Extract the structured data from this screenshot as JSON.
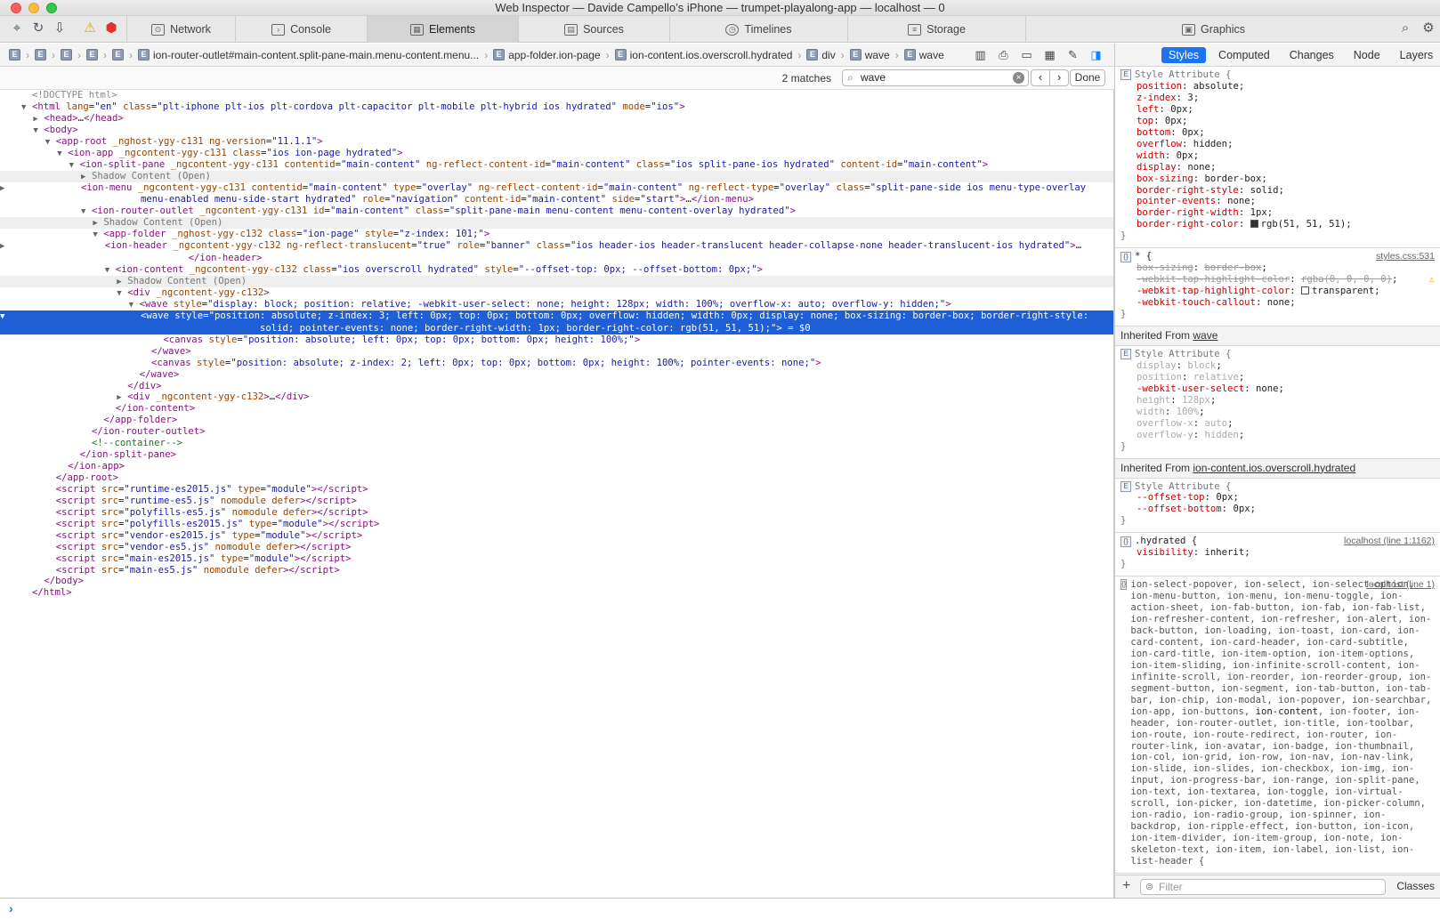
{
  "window": {
    "title": "Web Inspector — Davide Campello’s iPhone — trumpet-playalong-app — localhost — 0"
  },
  "toolbar": {
    "icons": [
      "crosshair-icon",
      "reload-icon",
      "download-icon",
      "warning-icon",
      "error-icon"
    ],
    "tabs": [
      {
        "label": "Network",
        "icon": "network-icon"
      },
      {
        "label": "Console",
        "icon": "console-icon"
      },
      {
        "label": "Elements",
        "icon": "elements-icon",
        "active": true
      },
      {
        "label": "Sources",
        "icon": "sources-icon"
      },
      {
        "label": "Timelines",
        "icon": "timelines-icon"
      },
      {
        "label": "Storage",
        "icon": "storage-icon"
      },
      {
        "label": "Graphics",
        "icon": "graphics-icon"
      }
    ]
  },
  "breadcrumb": {
    "items": [
      "",
      "",
      "",
      "",
      "",
      "ion-router-outlet#main-content.split-pane-main.menu-content.menu...",
      "app-folder.ion-page",
      "ion-content.ios.overscroll.hydrated",
      "div",
      "wave",
      "wave"
    ]
  },
  "sidebar_tabs": [
    "Styles",
    "Computed",
    "Changes",
    "Node",
    "Layers"
  ],
  "find": {
    "matches": "2 matches",
    "query": "wave",
    "done": "Done"
  },
  "dom_lines": [
    {
      "i": 0,
      "t": "none",
      "h": "<span class='dt'>&lt;!DOCTYPE html&gt;</span>"
    },
    {
      "i": 0,
      "t": "open",
      "h": "<span class='tg'>&lt;html</span> <span class='an'>lang</span>=<span class='av'>\"en\"</span> <span class='an'>class</span>=<span class='av'>\"plt-iphone plt-ios plt-cordova plt-capacitor plt-mobile plt-hybrid ios hydrated\"</span> <span class='an'>mode</span>=<span class='av'>\"ios\"</span><span class='tg'>&gt;</span>"
    },
    {
      "i": 1,
      "t": "closed",
      "h": "<span class='tg'>&lt;head&gt;</span><span class='tx'>…</span><span class='tg'>&lt;/head&gt;</span>"
    },
    {
      "i": 1,
      "t": "open",
      "h": "<span class='tg'>&lt;body&gt;</span>"
    },
    {
      "i": 2,
      "t": "open",
      "h": "<span class='tg'>&lt;app-root</span> <span class='an'>_nghost-ygy-c131</span> <span class='an'>ng-version</span>=<span class='av'>\"11.1.1\"</span><span class='tg'>&gt;</span>"
    },
    {
      "i": 3,
      "t": "open",
      "h": "<span class='tg'>&lt;ion-app</span> <span class='an'>_ngcontent-ygy-c131</span> <span class='an'>class</span>=<span class='av'>\"ios ion-page hydrated\"</span><span class='tg'>&gt;</span>"
    },
    {
      "i": 4,
      "t": "open",
      "h": "<span class='tg'>&lt;ion-split-pane</span> <span class='an'>_ngcontent-ygy-c131</span> <span class='an'>contentid</span>=<span class='av'>\"main-content\"</span> <span class='an'>ng-reflect-content-id</span>=<span class='av'>\"main-content\"</span> <span class='an'>class</span>=<span class='av'>\"ios split-pane-ios hydrated\"</span> <span class='an'>content-id</span>=<span class='av'>\"main-content\"</span><span class='tg'>&gt;</span>"
    },
    {
      "i": 5,
      "t": "closed",
      "c": "shadow",
      "h": "Shadow Content (Open)"
    },
    {
      "i": 5,
      "t": "closed",
      "w": true,
      "h": "<span class='tg'>&lt;ion-menu</span> <span class='an'>_ngcontent-ygy-c131</span> <span class='an'>contentid</span>=<span class='av'>\"main-content\"</span> <span class='an'>type</span>=<span class='av'>\"overlay\"</span> <span class='an'>ng-reflect-content-id</span>=<span class='av'>\"main-content\"</span> <span class='an'>ng-reflect-type</span>=<span class='av'>\"overlay\"</span> <span class='an'>class</span>=<span class='av'>\"split-pane-side ios menu-type-overlay menu-enabled menu-side-start hydrated\"</span> <span class='an'>role</span>=<span class='av'>\"navigation\"</span> <span class='an'>content-id</span>=<span class='av'>\"main-content\"</span> <span class='an'>side</span>=<span class='av'>\"start\"</span><span class='tg'>&gt;</span><span class='tx'>…</span><span class='tg'>&lt;/ion-menu&gt;</span>"
    },
    {
      "i": 5,
      "t": "open",
      "h": "<span class='tg'>&lt;ion-router-outlet</span> <span class='an'>_ngcontent-ygy-c131</span> <span class='an'>id</span>=<span class='av'>\"main-content\"</span> <span class='an'>class</span>=<span class='av'>\"split-pane-main menu-content menu-content-overlay hydrated\"</span><span class='tg'>&gt;</span>"
    },
    {
      "i": 6,
      "t": "closed",
      "c": "shadow",
      "h": "Shadow Content (Open)"
    },
    {
      "i": 6,
      "t": "open",
      "h": "<span class='tg'>&lt;app-folder</span> <span class='an'>_nghost-ygy-c132</span> <span class='an'>class</span>=<span class='av'>\"ion-page\"</span> <span class='an'>style</span>=<span class='av'>\"z-index: 101;\"</span><span class='tg'>&gt;</span>"
    },
    {
      "i": 7,
      "t": "closed",
      "w": true,
      "h": "<span class='tg'>&lt;ion-header</span> <span class='an'>_ngcontent-ygy-c132</span> <span class='an'>ng-reflect-translucent</span>=<span class='av'>\"true\"</span> <span class='an'>role</span>=<span class='av'>\"banner\"</span> <span class='an'>class</span>=<span class='av'>\"ios header-ios header-translucent header-collapse-none header-translucent-ios hydrated\"</span><span class='tg'>&gt;</span><span class='tx'>…</span><span class='tg'>&lt;/ion-header&gt;</span>"
    },
    {
      "i": 7,
      "t": "open",
      "h": "<span class='tg'>&lt;ion-content</span> <span class='an'>_ngcontent-ygy-c132</span> <span class='an'>class</span>=<span class='av'>\"ios overscroll hydrated\"</span> <span class='an'>style</span>=<span class='av'>\"--offset-top: 0px; --offset-bottom: 0px;\"</span><span class='tg'>&gt;</span>"
    },
    {
      "i": 8,
      "t": "closed",
      "c": "shadow",
      "h": "Shadow Content (Open)"
    },
    {
      "i": 8,
      "t": "open",
      "h": "<span class='tg'>&lt;div</span> <span class='an'>_ngcontent-ygy-c132</span><span class='tg'>&gt;</span>"
    },
    {
      "i": 9,
      "t": "open",
      "h": "<span class='tg'>&lt;wave</span> <span class='an'>style</span>=<span class='av'>\"display: block; position: relative; -webkit-user-select: none; height: 128px; width: 100%; overflow-x: auto; overflow-y: hidden;\"</span><span class='tg'>&gt;</span>"
    },
    {
      "i": 10,
      "t": "open",
      "c": "sel",
      "w": true,
      "h": "<span class='tg'>&lt;wave</span> <span class='an'>style</span>=<span class='av'>\"position: absolute; z-index: 3; left: 0px; top: 0px; bottom: 0px; overflow: hidden; width: 0px; display: none; box-sizing: border-box; border-right-style: solid; pointer-events: none; border-right-width: 1px; border-right-color: rgb(51, 51, 51);\"</span><span class='tg'>&gt;</span> = $0"
    },
    {
      "i": 11,
      "t": "none",
      "h": "<span class='tg'>&lt;canvas</span> <span class='an'>style</span>=<span class='av'>\"position: absolute; left: 0px; top: 0px; bottom: 0px; height: 100%;\"</span><span class='tg'>&gt;</span>"
    },
    {
      "i": 10,
      "t": "none",
      "h": "<span class='tg'>&lt;/wave&gt;</span>"
    },
    {
      "i": 10,
      "t": "none",
      "h": "<span class='tg'>&lt;canvas</span> <span class='an'>style</span>=<span class='av'>\"position: absolute; z-index: 2; left: 0px; top: 0px; bottom: 0px; height: 100%; pointer-events: none;\"</span><span class='tg'>&gt;</span>"
    },
    {
      "i": 9,
      "t": "none",
      "h": "<span class='tg'>&lt;/wave&gt;</span>"
    },
    {
      "i": 8,
      "t": "none",
      "h": "<span class='tg'>&lt;/div&gt;</span>"
    },
    {
      "i": 8,
      "t": "closed",
      "h": "<span class='tg'>&lt;div</span> <span class='an'>_ngcontent-ygy-c132</span><span class='tg'>&gt;</span><span class='tx'>…</span><span class='tg'>&lt;/div&gt;</span>"
    },
    {
      "i": 7,
      "t": "none",
      "h": "<span class='tg'>&lt;/ion-content&gt;</span>"
    },
    {
      "i": 6,
      "t": "none",
      "h": "<span class='tg'>&lt;/app-folder&gt;</span>"
    },
    {
      "i": 5,
      "t": "none",
      "h": "<span class='tg'>&lt;/ion-router-outlet&gt;</span>"
    },
    {
      "i": 5,
      "t": "none",
      "h": "<span class='cm'>&lt;!--container--&gt;</span>"
    },
    {
      "i": 4,
      "t": "none",
      "h": "<span class='tg'>&lt;/ion-split-pane&gt;</span>"
    },
    {
      "i": 3,
      "t": "none",
      "h": "<span class='tg'>&lt;/ion-app&gt;</span>"
    },
    {
      "i": 2,
      "t": "none",
      "h": "<span class='tg'>&lt;/app-root&gt;</span>"
    },
    {
      "i": 2,
      "t": "none",
      "h": "<span class='tg'>&lt;script</span> <span class='an'>src</span>=<span class='av'>\"runtime-es2015.js\"</span> <span class='an'>type</span>=<span class='av'>\"module\"</span><span class='tg'>&gt;&lt;/script&gt;</span>"
    },
    {
      "i": 2,
      "t": "none",
      "h": "<span class='tg'>&lt;script</span> <span class='an'>src</span>=<span class='av'>\"runtime-es5.js\"</span> <span class='an'>nomodule defer</span><span class='tg'>&gt;&lt;/script&gt;</span>"
    },
    {
      "i": 2,
      "t": "none",
      "h": "<span class='tg'>&lt;script</span> <span class='an'>src</span>=<span class='av'>\"polyfills-es5.js\"</span> <span class='an'>nomodule defer</span><span class='tg'>&gt;&lt;/script&gt;</span>"
    },
    {
      "i": 2,
      "t": "none",
      "h": "<span class='tg'>&lt;script</span> <span class='an'>src</span>=<span class='av'>\"polyfills-es2015.js\"</span> <span class='an'>type</span>=<span class='av'>\"module\"</span><span class='tg'>&gt;&lt;/script&gt;</span>"
    },
    {
      "i": 2,
      "t": "none",
      "h": "<span class='tg'>&lt;script</span> <span class='an'>src</span>=<span class='av'>\"vendor-es2015.js\"</span> <span class='an'>type</span>=<span class='av'>\"module\"</span><span class='tg'>&gt;&lt;/script&gt;</span>"
    },
    {
      "i": 2,
      "t": "none",
      "h": "<span class='tg'>&lt;script</span> <span class='an'>src</span>=<span class='av'>\"vendor-es5.js\"</span> <span class='an'>nomodule defer</span><span class='tg'>&gt;&lt;/script&gt;</span>"
    },
    {
      "i": 2,
      "t": "none",
      "h": "<span class='tg'>&lt;script</span> <span class='an'>src</span>=<span class='av'>\"main-es2015.js\"</span> <span class='an'>type</span>=<span class='av'>\"module\"</span><span class='tg'>&gt;&lt;/script&gt;</span>"
    },
    {
      "i": 2,
      "t": "none",
      "h": "<span class='tg'>&lt;script</span> <span class='an'>src</span>=<span class='av'>\"main-es5.js\"</span> <span class='an'>nomodule defer</span><span class='tg'>&gt;&lt;/script&gt;</span>"
    },
    {
      "i": 1,
      "t": "none",
      "h": "<span class='tg'>&lt;/body&gt;</span>"
    },
    {
      "i": 0,
      "t": "none",
      "h": "<span class='tg'>&lt;/html&gt;</span>"
    }
  ],
  "styles": {
    "rules": [
      {
        "icon": "E",
        "selector": "Style Attribute",
        "props": [
          [
            "position",
            "absolute"
          ],
          [
            "z-index",
            "3"
          ],
          [
            "left",
            "0px"
          ],
          [
            "top",
            "0px"
          ],
          [
            "bottom",
            "0px"
          ],
          [
            "overflow",
            "hidden"
          ],
          [
            "width",
            "0px"
          ],
          [
            "display",
            "none"
          ],
          [
            "box-sizing",
            "border-box"
          ],
          [
            "border-right-style",
            "solid"
          ],
          [
            "pointer-events",
            "none"
          ],
          [
            "border-right-width",
            "1px"
          ],
          [
            "border-right-color",
            "rgb(51, 51, 51)",
            "swatch:#333333"
          ]
        ]
      },
      {
        "icon": "{}",
        "selector": "*",
        "source": "styles.css:531",
        "props": [
          [
            "box-sizing",
            "border-box",
            "struck"
          ],
          [
            "-webkit-tap-highlight-color",
            "rgba(0, 0, 0, 0)",
            "struck-warn"
          ],
          [
            "-webkit-tap-highlight-color",
            "transparent",
            "swatch:#ffffff"
          ],
          [
            "-webkit-touch-callout",
            "none"
          ]
        ]
      },
      {
        "inherited": "wave"
      },
      {
        "icon": "E",
        "selector": "Style Attribute",
        "props": [
          [
            "display",
            "block",
            "dim"
          ],
          [
            "position",
            "relative",
            "dim"
          ],
          [
            "-webkit-user-select",
            "none"
          ],
          [
            "height",
            "128px",
            "dim"
          ],
          [
            "width",
            "100%",
            "dim"
          ],
          [
            "overflow-x",
            "auto",
            "dim"
          ],
          [
            "overflow-y",
            "hidden",
            "dim"
          ]
        ]
      },
      {
        "inherited": "ion-content.ios.overscroll.hydrated"
      },
      {
        "icon": "E",
        "selector": "Style Attribute",
        "props": [
          [
            "--offset-top",
            "0px"
          ],
          [
            "--offset-bottom",
            "0px"
          ]
        ]
      },
      {
        "icon": "{}",
        "selector": ".hydrated",
        "source": "localhost (line 1:1162)",
        "props": [
          [
            "visibility",
            "inherit"
          ]
        ]
      },
      {
        "icon": "{}",
        "source": "localhost (line 1)",
        "selector_list": "ion-select-popover, ion-select, ion-select-option, ion-menu-button, ion-menu, ion-menu-toggle, ion-action-sheet, ion-fab-button, ion-fab, ion-fab-list, ion-refresher-content, ion-refresher, ion-alert, ion-back-button, ion-loading, ion-toast, ion-card, ion-card-content, ion-card-header, ion-card-subtitle, ion-card-title, ion-item-option, ion-item-options, ion-item-sliding, ion-infinite-scroll-content, ion-infinite-scroll, ion-reorder, ion-reorder-group, ion-segment-button, ion-segment, ion-tab-button, ion-tab-bar, ion-chip, ion-modal, ion-popover, ion-searchbar, ion-app, ion-buttons, ion-content, ion-footer, ion-header, ion-router-outlet, ion-title, ion-toolbar, ion-route, ion-route-redirect, ion-router, ion-router-link, ion-avatar, ion-badge, ion-thumbnail, ion-col, ion-grid, ion-row, ion-nav, ion-nav-link, ion-slide, ion-slides, ion-checkbox, ion-img, ion-input, ion-progress-bar, ion-range, ion-split-pane, ion-text, ion-textarea, ion-toggle, ion-virtual-scroll, ion-picker, ion-datetime, ion-picker-column, ion-radio, ion-radio-group, ion-spinner, ion-backdrop, ion-ripple-effect, ion-button, ion-icon, ion-item-divider, ion-item-group, ion-note, ion-skeleton-text, ion-item, ion-label, ion-list, ion-list-header {"
      }
    ]
  },
  "filter": {
    "placeholder": "Filter",
    "classes_label": "Classes"
  },
  "colors": {
    "selection": "#1f5fd6",
    "active_tab": "#1e74f0",
    "tag": "#881280",
    "attr_name": "#994500",
    "attr_value": "#1a1aa6"
  }
}
